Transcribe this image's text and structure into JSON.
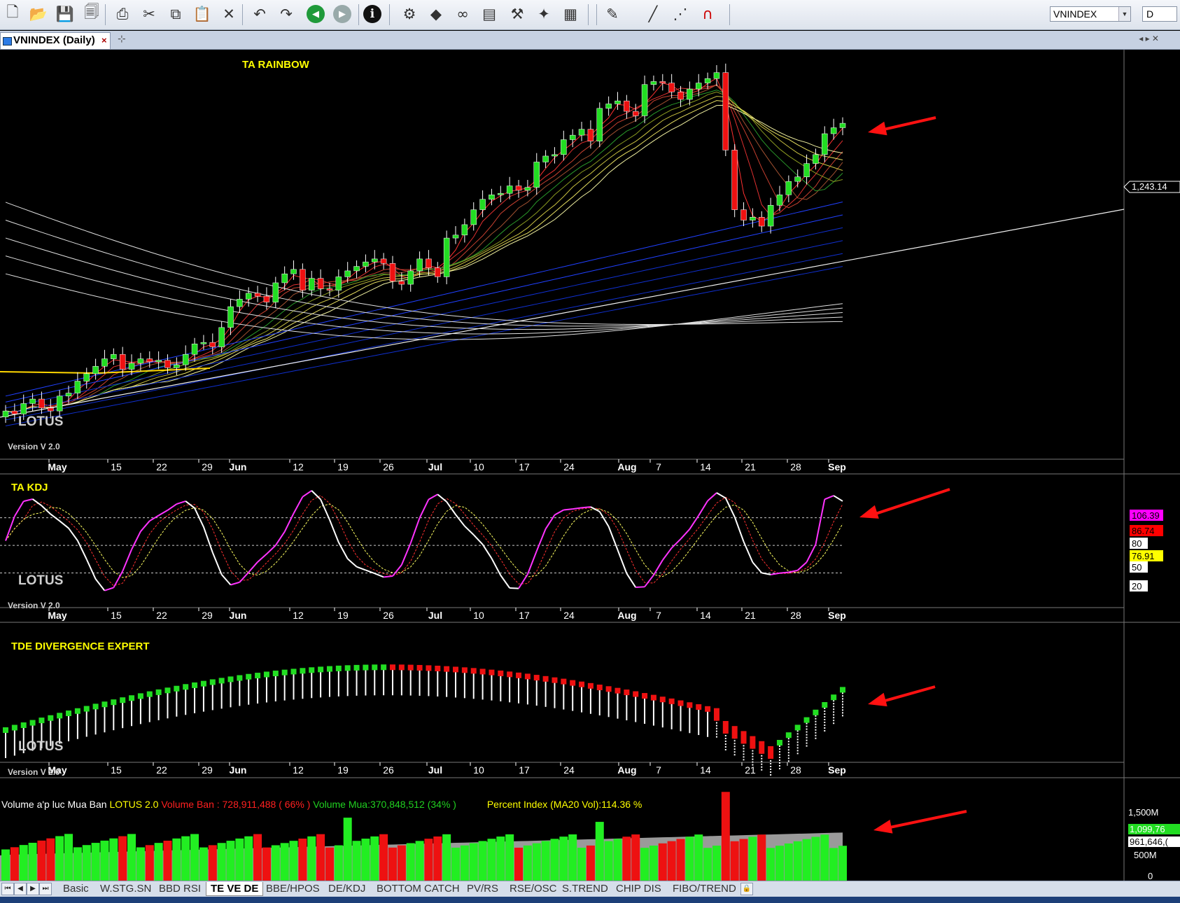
{
  "toolbar": {
    "symbol": "VNINDEX",
    "period": "D",
    "icons": [
      "new-file-icon",
      "open-folder-icon",
      "save-icon",
      "save-all-icon",
      "print-icon",
      "cut-icon",
      "copy-icon",
      "paste-icon",
      "delete-icon",
      "undo-icon",
      "redo-icon",
      "back-icon",
      "forward-icon",
      "info-icon",
      "indicator-icon",
      "analysis-icon",
      "glasses-icon",
      "template-icon",
      "hammer-icon",
      "tools-icon",
      "chart-export-icon",
      "pen-icon",
      "line-icon",
      "dotted-line-icon",
      "magnet-icon"
    ]
  },
  "document_tab": {
    "title": "VNINDEX (Daily)",
    "close": "×"
  },
  "panels": {
    "price": {
      "title": "TA RAINBOW",
      "lotus": "LOTUS",
      "version": "Version V 2.0",
      "last_price": "1,243.14"
    },
    "kdj": {
      "title": "TA KDJ",
      "lotus": "LOTUS",
      "version": "Version V 2.0",
      "labels": [
        {
          "text": "106.39",
          "bg": "#ff00ff",
          "fg": "#000000"
        },
        {
          "text": "86.74",
          "bg": "#ff0000",
          "fg": "#000000"
        },
        {
          "text": "80",
          "bg": "#ffffff",
          "fg": "#000000"
        },
        {
          "text": "76.91",
          "bg": "#ffff00",
          "fg": "#000000"
        },
        {
          "text": "50",
          "bg": "#ffffff",
          "fg": "#000000"
        },
        {
          "text": "20",
          "bg": "#ffffff",
          "fg": "#000000"
        }
      ]
    },
    "divergence": {
      "title": "TDE DIVERGENCE EXPERT",
      "lotus": "LOTUS",
      "version": "Version V 2.0"
    },
    "volume": {
      "title": "Volume a'p luc Mua Ban",
      "version": "LOTUS 2.0",
      "sell": "Volume Ban : 728,911,488 ( 66% )",
      "buy": "Volume Mua:370,848,512 (34% )",
      "percent": "Percent Index (MA20 Vol):114.36 %",
      "axis": [
        "1,500M",
        "1,099,76",
        "961,646,(",
        "500M",
        "0"
      ]
    }
  },
  "x_axis_labels": [
    "May",
    "15",
    "22",
    "29",
    "Jun",
    "12",
    "19",
    "26",
    "Jul",
    "10",
    "17",
    "24",
    "Aug",
    "7",
    "14",
    "21",
    "28",
    "Sep"
  ],
  "bottom_tabs": [
    "Basic",
    "W.STG.SN",
    "BBD RSI",
    "TE VE DE",
    "BBE/HPOS",
    "DE/KDJ",
    "BOTTOM CATCH",
    "PV/RS",
    "RSE/OSC",
    "S.TREND",
    "CHIP DIS",
    "FIBO/TREND"
  ],
  "active_tab": "TE VE DE",
  "chart_data": {
    "type": "candlestick",
    "symbol": "VNINDEX",
    "interval": "Daily",
    "closes": [
      1050,
      1048,
      1055,
      1058,
      1052,
      1050,
      1060,
      1062,
      1070,
      1075,
      1080,
      1085,
      1088,
      1078,
      1082,
      1085,
      1083,
      1084,
      1079,
      1081,
      1088,
      1095,
      1096,
      1093,
      1106,
      1120,
      1125,
      1129,
      1127,
      1123,
      1136,
      1142,
      1145,
      1131,
      1139,
      1132,
      1131,
      1140,
      1144,
      1147,
      1150,
      1152,
      1149,
      1137,
      1135,
      1144,
      1152,
      1146,
      1140,
      1166,
      1168,
      1175,
      1185,
      1192,
      1195,
      1196,
      1201,
      1198,
      1200,
      1217,
      1221,
      1222,
      1232,
      1235,
      1239,
      1231,
      1253,
      1256,
      1258,
      1251,
      1248,
      1269,
      1271,
      1270,
      1264,
      1259,
      1266,
      1270,
      1273,
      1277,
      1225,
      1185,
      1178,
      1180,
      1174,
      1188,
      1195,
      1204,
      1207,
      1216,
      1222,
      1236,
      1240,
      1243
    ],
    "kdj_last": {
      "K": 106.39,
      "D": 86.74,
      "J": 76.91
    },
    "kdj_levels": [
      80,
      50,
      20
    ],
    "volume_axis": [
      "1,500M",
      "500M",
      "0"
    ]
  }
}
